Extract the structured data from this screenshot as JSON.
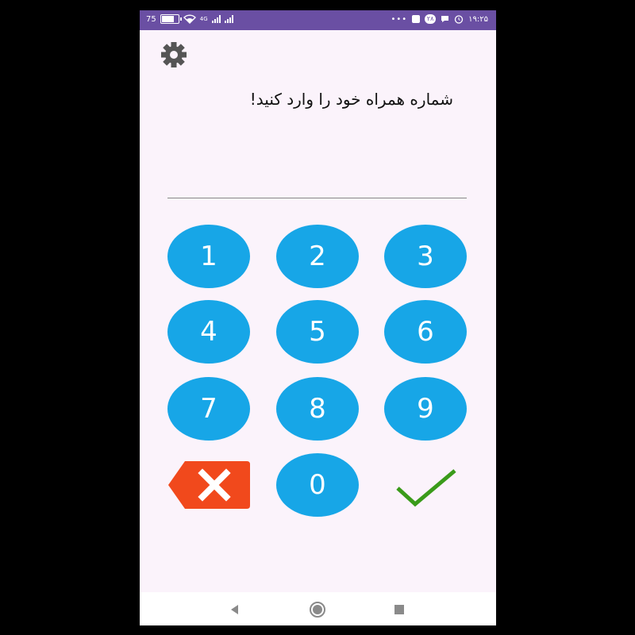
{
  "status_bar": {
    "battery_text": "75",
    "battery_level": 0.75,
    "network": "4G",
    "badge_count": "۲۸",
    "time": "۱۹:۲۵"
  },
  "prompt": "شماره همراه خود را وارد کنید!",
  "phone_input": {
    "value": ""
  },
  "keypad": {
    "keys": [
      "1",
      "2",
      "3",
      "4",
      "5",
      "6",
      "7",
      "8",
      "9",
      "0"
    ]
  },
  "colors": {
    "status_bar": "#6a4fa3",
    "background": "#fbf3fb",
    "key": "#17a6e7",
    "delete": "#f1491c",
    "confirm": "#3a9b1a"
  },
  "icons": {
    "settings": "gear-icon",
    "delete": "backspace-x-icon",
    "confirm": "checkmark-icon",
    "nav_back": "triangle-back-icon",
    "nav_home": "circle-home-icon",
    "nav_recents": "square-recents-icon"
  }
}
